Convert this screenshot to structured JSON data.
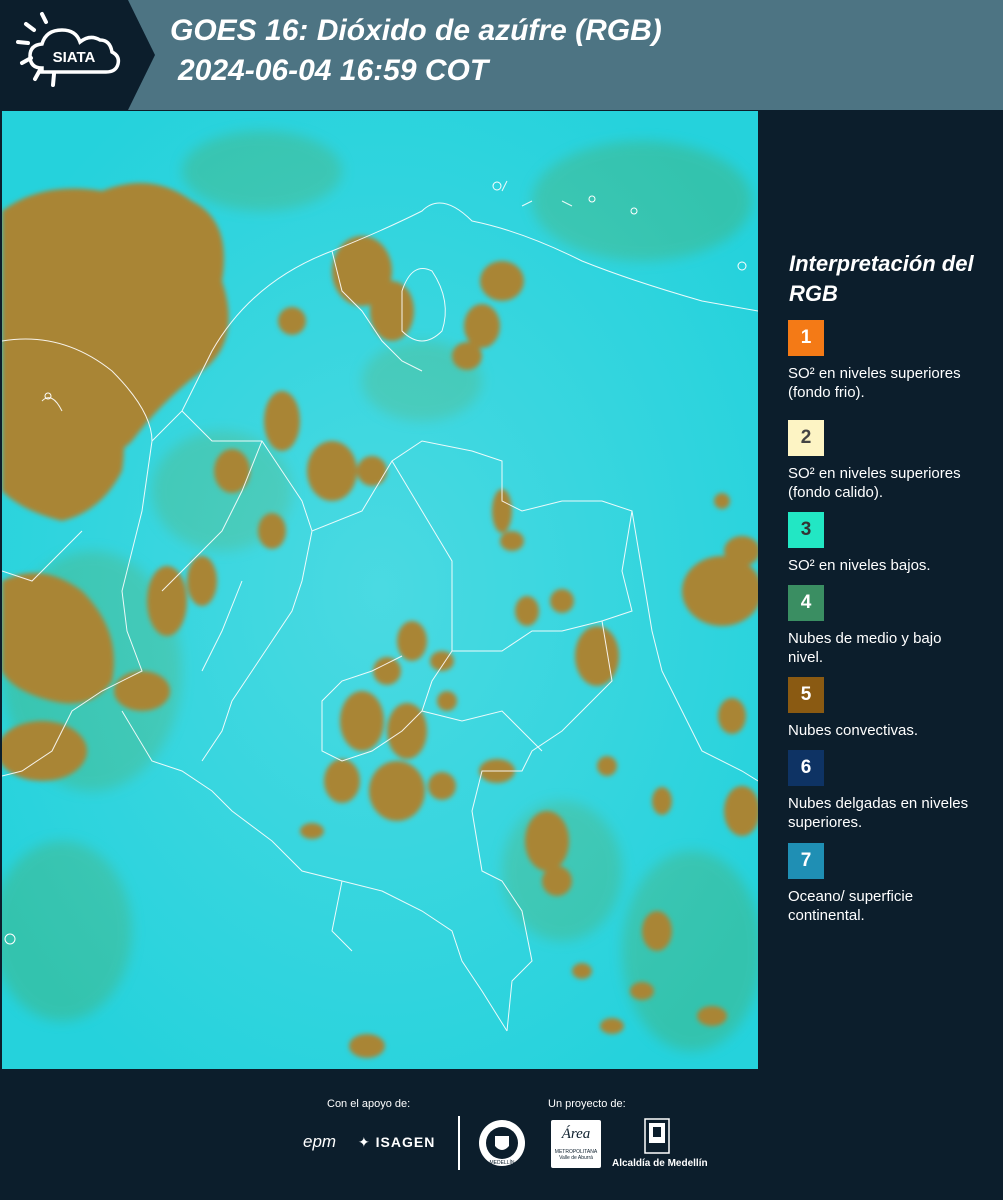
{
  "header": {
    "brand": "SIATA",
    "title_line1": "GOES 16: Dióxido de azúfre (RGB)",
    "title_line2": "2024-06-04 16:59 COT",
    "background": "#4d7483"
  },
  "map": {
    "ocean_color": "#26d3dd",
    "cloud_color": "#a98432",
    "border_color": "#ffffff"
  },
  "legend": {
    "title": "Interpretación del RGB",
    "items": [
      {
        "number": "1",
        "label": "SO² en niveles superiores (fondo frio).",
        "color": "#f47a16",
        "text_color": "#ffffff"
      },
      {
        "number": "2",
        "label": "SO² en niveles superiores (fondo calido).",
        "color": "#fdf4c4",
        "text_color": "#444444"
      },
      {
        "number": "3",
        "label": "SO² en niveles bajos.",
        "color": "#22e7c4",
        "text_color": "#333333"
      },
      {
        "number": "4",
        "label": "Nubes de medio y bajo nivel.",
        "color": "#3a8e62",
        "text_color": "#ffffff"
      },
      {
        "number": "5",
        "label": "Nubes convectivas.",
        "color": "#8a5a12",
        "text_color": "#ffffff"
      },
      {
        "number": "6",
        "label": "Nubes delgadas en niveles superiores.",
        "color": "#0e3364",
        "text_color": "#ffffff"
      },
      {
        "number": "7",
        "label": "Oceano/ superficie continental.",
        "color": "#1f8fb4",
        "text_color": "#ffffff"
      }
    ]
  },
  "footer": {
    "support_label": "Con el apoyo de:",
    "project_label": "Un proyecto de:",
    "sponsors": {
      "epm": "epm",
      "isagen": "ISAGEN",
      "metropolitana_logo": "Área",
      "metropolitana_line1": "METROPOLITANA",
      "metropolitana_line2": "Valle de Aburrá",
      "alcaldia": "Alcaldía de Medellín",
      "seal_text": "MEDELLÍN"
    }
  }
}
